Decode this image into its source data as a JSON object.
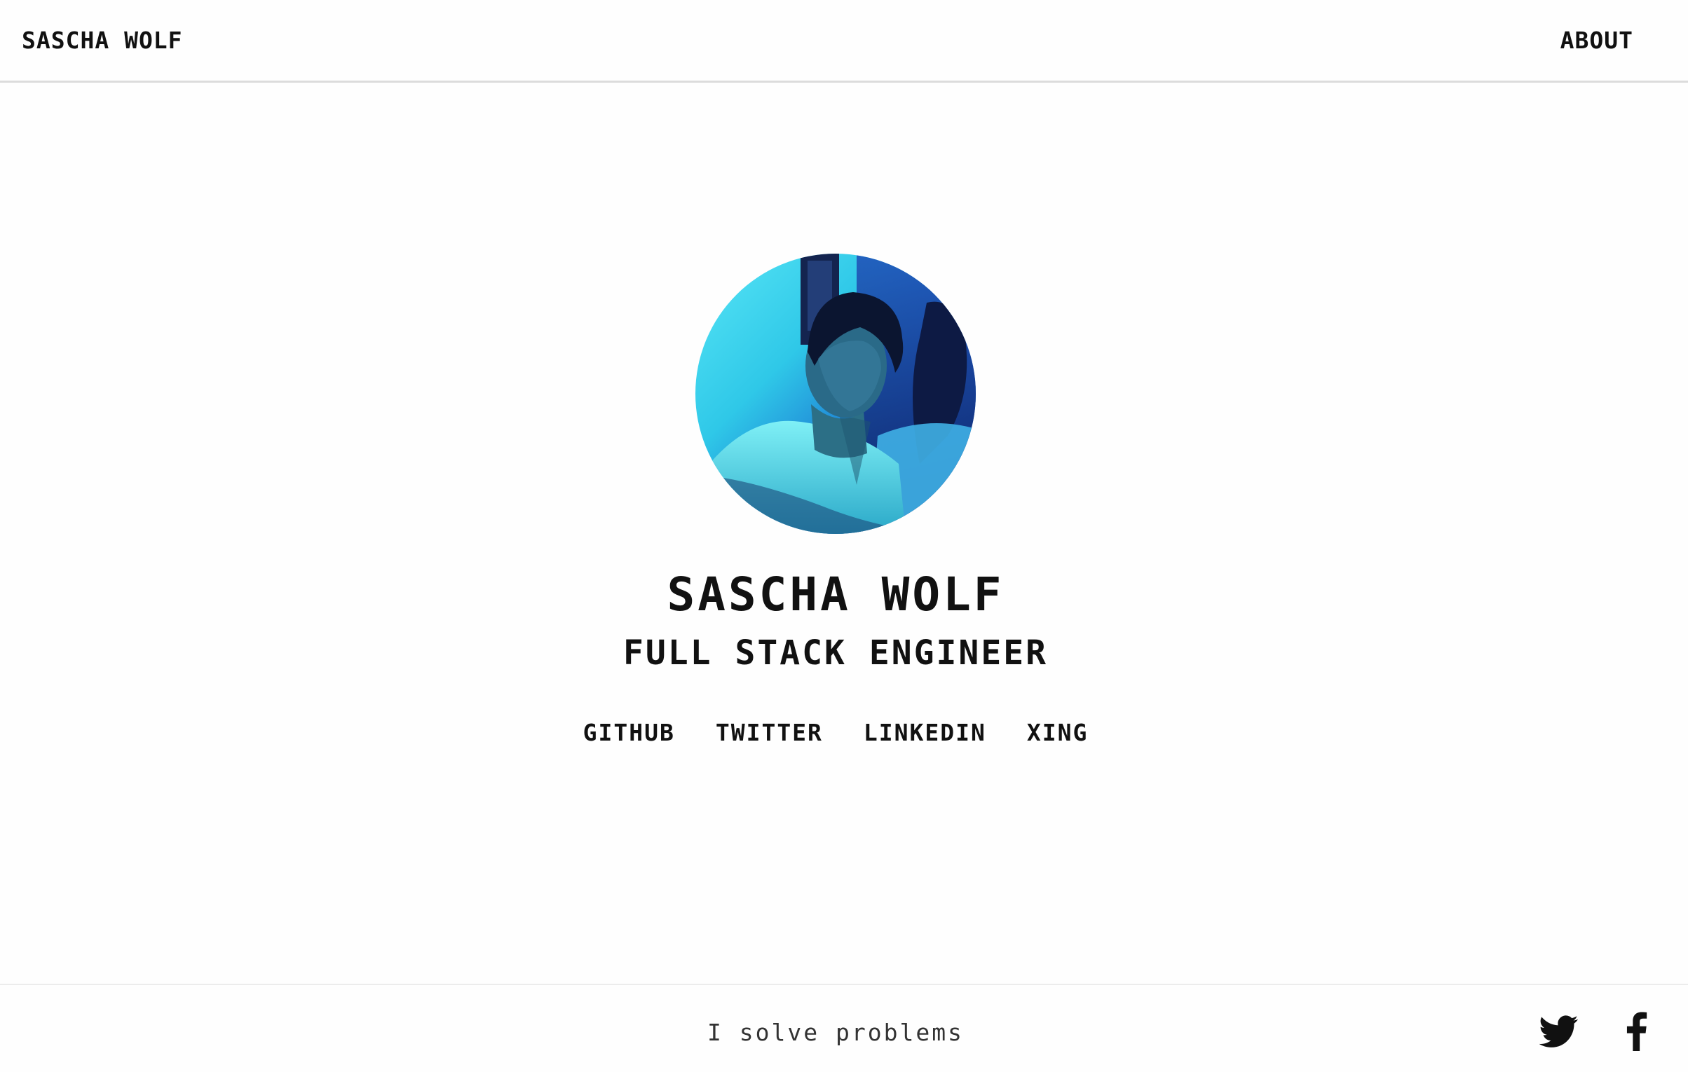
{
  "header": {
    "brand": "SASCHA WOLF",
    "nav": [
      {
        "label": "ABOUT"
      }
    ]
  },
  "hero": {
    "avatar_icon": "profile-photo",
    "name": "SASCHA WOLF",
    "role": "FULL STACK ENGINEER",
    "links": [
      {
        "label": "GITHUB"
      },
      {
        "label": "TWITTER"
      },
      {
        "label": "LINKEDIN"
      },
      {
        "label": "XING"
      }
    ]
  },
  "footer": {
    "tagline": "I solve problems",
    "social": [
      {
        "icon": "twitter-icon"
      },
      {
        "icon": "facebook-icon"
      }
    ]
  },
  "colors": {
    "background": "#fefefe",
    "text": "#111111",
    "divider": "#dcdcdc",
    "photo_accent": "#3fd6ee"
  }
}
